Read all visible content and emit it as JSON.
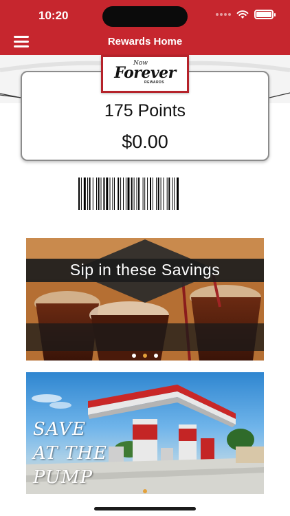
{
  "status_bar": {
    "time": "10:20"
  },
  "header": {
    "title": "Rewards Home"
  },
  "logo": {
    "prefix": "Now",
    "main": "Forever",
    "sub": "REWARDS"
  },
  "rewards": {
    "points": "175 Points",
    "balance": "$0.00"
  },
  "banners": [
    {
      "title": "Sip in these Savings",
      "dots": 3,
      "active_dot": 1
    },
    {
      "lines": [
        "SAVE",
        "AT THE",
        "PUMP"
      ],
      "dots": 1,
      "active_dot": 0
    }
  ],
  "colors": {
    "brand_red": "#c6262e",
    "accent_orange": "#e3a13a"
  }
}
